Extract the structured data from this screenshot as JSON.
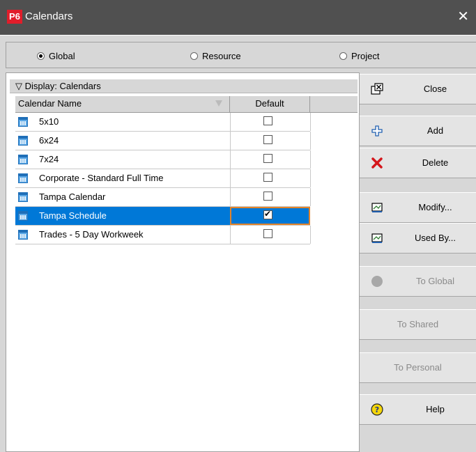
{
  "window": {
    "logo": "P6",
    "title": "Calendars",
    "close_glyph": "✕"
  },
  "scope": {
    "options": [
      {
        "label": "Global",
        "selected": true
      },
      {
        "label": "Resource",
        "selected": false
      },
      {
        "label": "Project",
        "selected": false
      }
    ]
  },
  "table": {
    "group_header": "▽ Display: Calendars",
    "columns": {
      "name": "Calendar Name",
      "default": "Default"
    },
    "rows": [
      {
        "name": "5x10",
        "default": false,
        "selected": false
      },
      {
        "name": "6x24",
        "default": false,
        "selected": false
      },
      {
        "name": "7x24",
        "default": false,
        "selected": false
      },
      {
        "name": "Corporate - Standard Full Time",
        "default": false,
        "selected": false
      },
      {
        "name": "Tampa Calendar",
        "default": false,
        "selected": false
      },
      {
        "name": "Tampa Schedule",
        "default": true,
        "selected": true
      },
      {
        "name": "Trades -  5 Day Workweek",
        "default": false,
        "selected": false
      }
    ]
  },
  "buttons": {
    "close": "Close",
    "add": "Add",
    "delete": "Delete",
    "modify": "Modify...",
    "used_by": "Used By...",
    "to_global": "To Global",
    "to_shared": "To Shared",
    "to_personal": "To Personal",
    "help": "Help"
  },
  "icons": {
    "close": "close-window-icon",
    "add": "plus-icon",
    "delete": "red-x-icon",
    "modify": "edit-calendar-icon",
    "used_by": "used-by-icon",
    "to_global": "gray-circle-icon",
    "help": "help-question-icon",
    "row": "calendar-icon"
  },
  "colors": {
    "selection": "#0078d7",
    "focus_border": "#e2832a",
    "logo": "#e11d2a"
  }
}
